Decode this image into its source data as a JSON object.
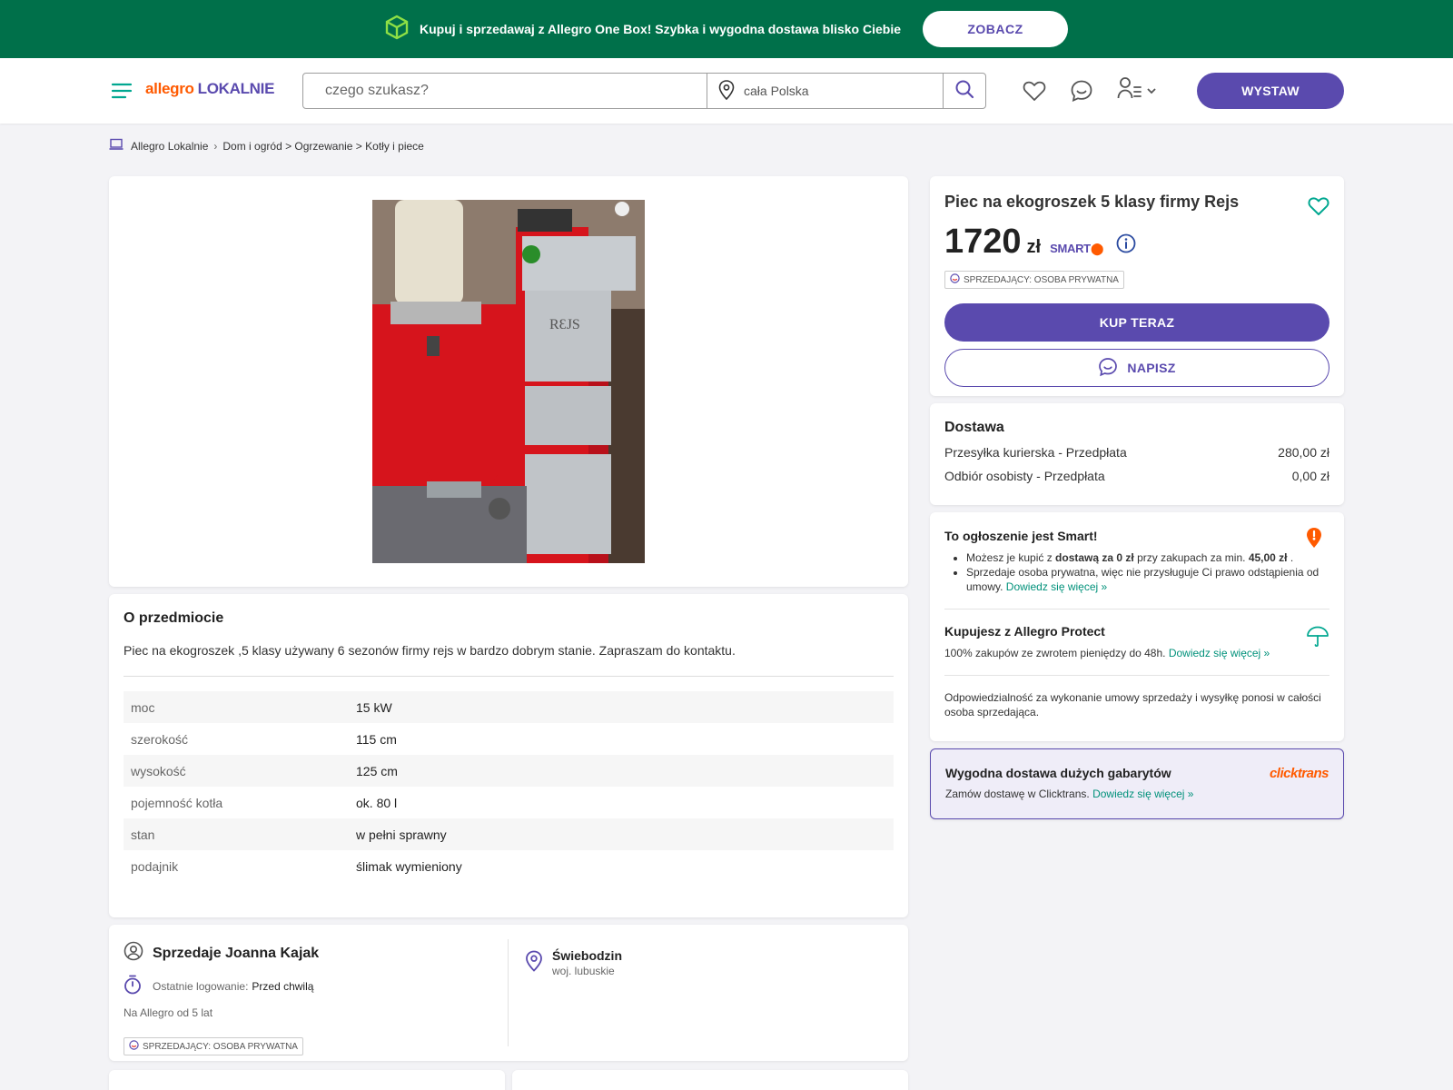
{
  "promo": {
    "text": "Kupuj i sprzedawaj z Allegro One Box! Szybka i wygodna dostawa blisko Ciebie",
    "button": "ZOBACZ",
    "icon": "box-icon"
  },
  "header": {
    "logo_part1": "allegro",
    "logo_part2": "LOKALNIE",
    "search_placeholder": "czego szukasz?",
    "location": "cała Polska",
    "post_button": "WYSTAW"
  },
  "breadcrumb": {
    "root": "Allegro Lokalnie",
    "path": "Dom i ogród > Ogrzewanie > Kotły i piece"
  },
  "listing": {
    "title": "Piec na ekogroszek 5 klasy firmy Rejs",
    "price": "1720",
    "currency": "zł",
    "smart_label": "SMART",
    "seller_type": "SPRZEDAJĄCY: OSOBA PRYWATNA",
    "buy_button": "KUP TERAZ",
    "message_button": "NAPISZ"
  },
  "about": {
    "heading": "O przedmiocie",
    "description": "Piec na ekogroszek ,5 klasy używany 6 sezonów firmy rejs w bardzo dobrym stanie. Zapraszam do kontaktu.",
    "params": [
      {
        "key": "moc",
        "value": "15 kW"
      },
      {
        "key": "szerokość",
        "value": "115 cm"
      },
      {
        "key": "wysokość",
        "value": "125 cm"
      },
      {
        "key": "pojemność kotła",
        "value": "ok. 80 l"
      },
      {
        "key": "stan",
        "value": "w pełni sprawny"
      },
      {
        "key": "podajnik",
        "value": "ślimak wymieniony"
      }
    ]
  },
  "seller": {
    "name": "Sprzedaje Joanna Kajak",
    "last_login_label": "Ostatnie logowanie:",
    "last_login_value": "Przed chwilą",
    "since": "Na Allegro od 5 lat",
    "badge": "SPRZEDAJĄCY: OSOBA PRYWATNA",
    "city": "Świebodzin",
    "region": "woj. lubuskie"
  },
  "delivery": {
    "heading": "Dostawa",
    "options": [
      {
        "name": "Przesyłka kurierska - Przedpłata",
        "price": "280,00 zł"
      },
      {
        "name": "Odbiór osobisty - Przedpłata",
        "price": "0,00 zł"
      }
    ]
  },
  "smart_info": {
    "heading": "To ogłoszenie jest Smart!",
    "b1_pre": "Możesz je kupić z ",
    "b1_bold": "dostawą za 0 zł",
    "b1_mid": " przy zakupach za min. ",
    "b1_amount": "45,00 zł",
    "b1_end": " .",
    "b2": "Sprzedaje osoba prywatna, więc nie przysługuje Ci prawo odstąpienia od umowy.",
    "more": "Dowiedz się więcej »",
    "protect_heading": "Kupujesz z Allegro Protect",
    "protect_text": "100% zakupów ze zwrotem pieniędzy do 48h.",
    "responsibility": "Odpowiedzialność za wykonanie umowy sprzedaży i wysyłkę ponosi w całości osoba sprzedająca."
  },
  "clicktrans": {
    "heading": "Wygodna dostawa dużych gabarytów",
    "text": "Zamów dostawę w Clicktrans.",
    "more": "Dowiedz się więcej »",
    "logo": "clicktrans"
  },
  "colors": {
    "promo_bg": "#00704a",
    "brand_orange": "#ff5a00",
    "brand_purple": "#5a4aae",
    "link": "#00917a"
  }
}
